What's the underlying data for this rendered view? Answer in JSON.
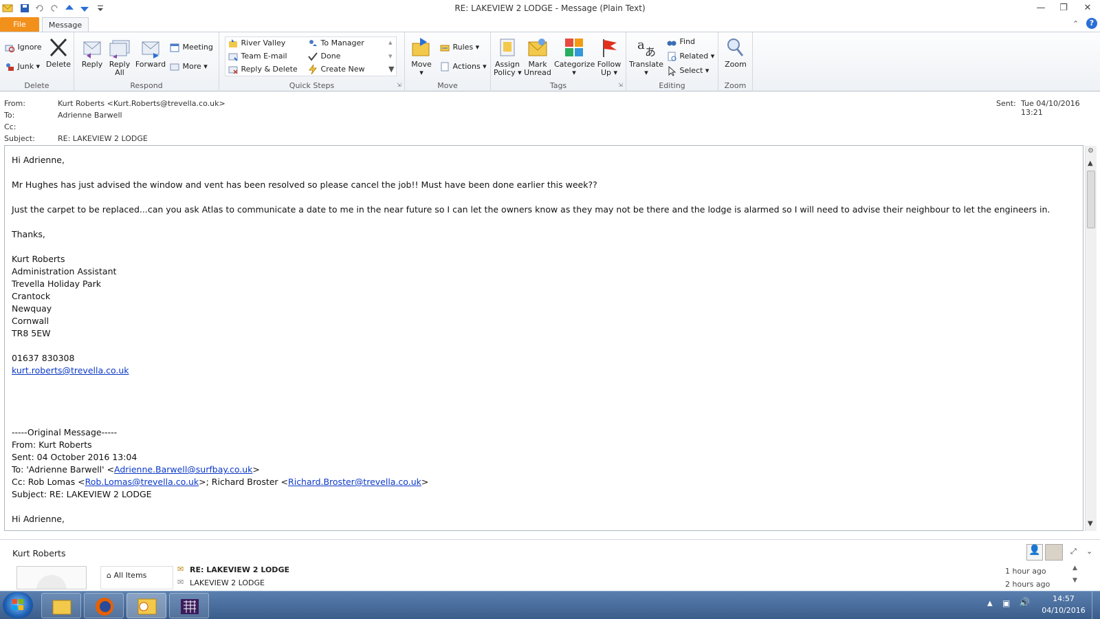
{
  "window": {
    "title": "RE: LAKEVIEW 2 LODGE  -  Message (Plain Text)"
  },
  "tabs": {
    "file": "File",
    "message": "Message"
  },
  "ribbon": {
    "delete": {
      "label": "Delete",
      "ignore": "Ignore",
      "junk": "Junk",
      "delete": "Delete"
    },
    "respond": {
      "label": "Respond",
      "reply": "Reply",
      "reply_all_1": "Reply",
      "reply_all_2": "All",
      "forward": "Forward",
      "meeting": "Meeting",
      "more": "More"
    },
    "quick_steps": {
      "label": "Quick Steps",
      "items": [
        "River Valley",
        "Team E-mail",
        "Reply & Delete",
        "To Manager",
        "Done",
        "Create New"
      ]
    },
    "move": {
      "label": "Move",
      "move": "Move",
      "rules": "Rules",
      "actions": "Actions"
    },
    "tags": {
      "label": "Tags",
      "assign_1": "Assign",
      "assign_2": "Policy",
      "mark_1": "Mark",
      "mark_2": "Unread",
      "categorize": "Categorize",
      "follow_1": "Follow",
      "follow_2": "Up"
    },
    "editing": {
      "label": "Editing",
      "translate": "Translate",
      "find": "Find",
      "related": "Related",
      "select": "Select"
    },
    "zoom": {
      "label": "Zoom",
      "zoom": "Zoom"
    }
  },
  "header": {
    "from_label": "From:",
    "from_value": "Kurt Roberts <Kurt.Roberts@trevella.co.uk>",
    "to_label": "To:",
    "to_value": "Adrienne Barwell",
    "cc_label": "Cc:",
    "subject_label": "Subject:",
    "subject_value": "RE: LAKEVIEW 2 LODGE",
    "sent_label": "Sent:",
    "sent_value": "Tue 04/10/2016 13:21"
  },
  "body": {
    "greeting": "Hi Adrienne,",
    "p1": "Mr Hughes has just advised the window and vent has been resolved so please cancel the job!! Must have been done earlier this week??",
    "p2": "Just the carpet to be replaced...can you ask Atlas to communicate a date to me in the near future so I can let the owners know as they may not be there and the lodge is alarmed so I will need to advise their neighbour to let the engineers in.",
    "thanks": "Thanks,",
    "sig": [
      "Kurt Roberts",
      "Administration Assistant",
      "Trevella Holiday Park",
      "Crantock",
      "Newquay",
      "Cornwall",
      "TR8 5EW"
    ],
    "phone": "01637 830308",
    "email": "kurt.roberts@trevella.co.uk",
    "orig_sep": "-----Original Message-----",
    "orig_from": "From: Kurt Roberts",
    "orig_sent": "Sent: 04 October 2016 13:04",
    "orig_to_pre": "To: 'Adrienne Barwell' <",
    "orig_to_email": "Adrienne.Barwell@surfbay.co.uk",
    "orig_to_post": ">",
    "orig_cc_pre": "Cc: Rob Lomas <",
    "orig_cc_email1": "Rob.Lomas@trevella.co.uk",
    "orig_cc_mid": ">; Richard Broster <",
    "orig_cc_email2": "Richard.Broster@trevella.co.uk",
    "orig_cc_post": ">",
    "orig_subject": "Subject: RE: LAKEVIEW 2 LODGE",
    "orig_greeting": "Hi Adrienne,"
  },
  "people_pane": {
    "name": "Kurt Roberts",
    "all_items": "All Items",
    "items": [
      {
        "subject": "RE: LAKEVIEW 2 LODGE",
        "time": "1 hour ago"
      },
      {
        "subject": "LAKEVIEW 2 LODGE",
        "time": "2 hours ago"
      }
    ]
  },
  "taskbar": {
    "time": "14:57",
    "date": "04/10/2016"
  }
}
